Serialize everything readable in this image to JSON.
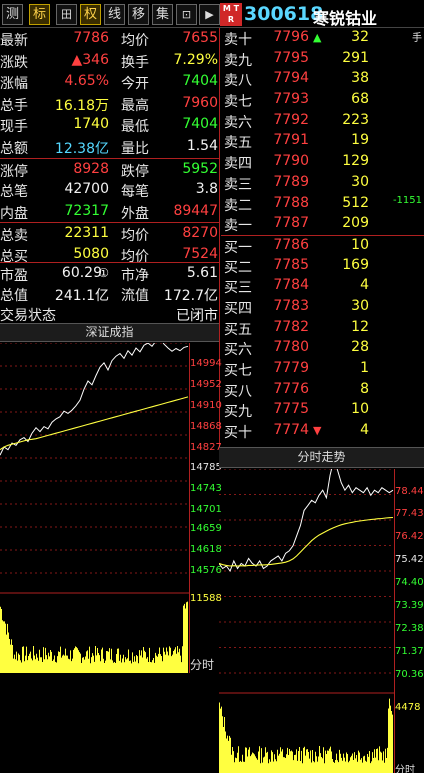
{
  "toolbar": {
    "buttons": [
      {
        "label": "测",
        "active": false
      },
      {
        "label": "标",
        "active": true
      },
      {
        "label": "田",
        "active": false
      },
      {
        "label": "权",
        "active": true
      },
      {
        "label": "线",
        "active": false
      },
      {
        "label": "移",
        "active": false
      },
      {
        "label": "集",
        "active": false
      },
      {
        "label": "⊡",
        "active": false
      },
      {
        "label": "▶",
        "active": false
      }
    ],
    "badge": "M T R",
    "code": "300618",
    "name": "寒锐钴业"
  },
  "quote": {
    "rows": [
      {
        "l1": "最新",
        "v1": "7786",
        "c1": "red",
        "l2": "均价",
        "v2": "7655",
        "c2": "red"
      },
      {
        "l1": "涨跌",
        "v1": "▲346",
        "c1": "red",
        "l2": "换手",
        "v2": "7.29%",
        "c2": "yellow"
      },
      {
        "l1": "涨幅",
        "v1": "4.65%",
        "c1": "red",
        "l2": "今开",
        "v2": "7404",
        "c2": "green"
      },
      {
        "l1": "总手",
        "v1": "16.18万",
        "c1": "yellow",
        "l2": "最高",
        "v2": "7960",
        "c2": "red"
      },
      {
        "l1": "现手",
        "v1": "1740",
        "c1": "yellow",
        "l2": "最低",
        "v2": "7404",
        "c2": "green"
      },
      {
        "l1": "总额",
        "v1": "12.38亿",
        "c1": "cyan",
        "l2": "量比",
        "v2": "1.54",
        "c2": "white"
      },
      {
        "l1": "涨停",
        "v1": "8928",
        "c1": "red",
        "l2": "跌停",
        "v2": "5952",
        "c2": "green"
      },
      {
        "l1": "总笔",
        "v1": "42700",
        "c1": "white",
        "l2": "每笔",
        "v2": "3.8",
        "c2": "white"
      },
      {
        "l1": "内盘",
        "v1": "72317",
        "c1": "green",
        "l2": "外盘",
        "v2": "89447",
        "c2": "red"
      },
      {
        "l1": "总卖",
        "v1": "22311",
        "c1": "yellow",
        "l2": "均价",
        "v2": "8270",
        "c2": "red"
      },
      {
        "l1": "总买",
        "v1": "5080",
        "c1": "yellow",
        "l2": "均价",
        "v2": "7524",
        "c2": "red"
      }
    ],
    "extra": [
      {
        "l1": "市盈",
        "v1": "60.29",
        "v1b": "①",
        "l2": "市净",
        "v2": "5.61"
      },
      {
        "l1": "总值",
        "v1": "241.1亿",
        "v1b": "",
        "l2": "流值",
        "v2": "172.7亿"
      }
    ],
    "status_label": "交易状态",
    "status_value": "已闭市"
  },
  "book": {
    "rows": [
      {
        "label": "卖十",
        "price": "7796",
        "vol": "32",
        "mark": "▲",
        "extra": "手"
      },
      {
        "label": "卖九",
        "price": "7795",
        "vol": "291",
        "mark": "",
        "extra": ""
      },
      {
        "label": "卖八",
        "price": "7794",
        "vol": "38",
        "mark": "",
        "extra": ""
      },
      {
        "label": "卖七",
        "price": "7793",
        "vol": "68",
        "mark": "",
        "extra": ""
      },
      {
        "label": "卖六",
        "price": "7792",
        "vol": "223",
        "mark": "",
        "extra": ""
      },
      {
        "label": "卖五",
        "price": "7791",
        "vol": "19",
        "mark": "",
        "extra": ""
      },
      {
        "label": "卖四",
        "price": "7790",
        "vol": "129",
        "mark": "",
        "extra": ""
      },
      {
        "label": "卖三",
        "price": "7789",
        "vol": "30",
        "mark": "",
        "extra": ""
      },
      {
        "label": "卖二",
        "price": "7788",
        "vol": "512",
        "mark": "",
        "extra": "-1151"
      },
      {
        "label": "卖一",
        "price": "7787",
        "vol": "209",
        "mark": "",
        "extra": ""
      },
      {
        "label": "买一",
        "price": "7786",
        "vol": "10",
        "mark": "",
        "extra": ""
      },
      {
        "label": "买二",
        "price": "7785",
        "vol": "169",
        "mark": "",
        "extra": ""
      },
      {
        "label": "买三",
        "price": "7784",
        "vol": "4",
        "mark": "",
        "extra": ""
      },
      {
        "label": "买四",
        "price": "7783",
        "vol": "30",
        "mark": "",
        "extra": ""
      },
      {
        "label": "买五",
        "price": "7782",
        "vol": "12",
        "mark": "",
        "extra": ""
      },
      {
        "label": "买六",
        "price": "7780",
        "vol": "28",
        "mark": "",
        "extra": ""
      },
      {
        "label": "买七",
        "price": "7779",
        "vol": "1",
        "mark": "",
        "extra": ""
      },
      {
        "label": "买八",
        "price": "7776",
        "vol": "8",
        "mark": "",
        "extra": ""
      },
      {
        "label": "买九",
        "price": "7775",
        "vol": "10",
        "mark": "",
        "extra": ""
      },
      {
        "label": "买十",
        "price": "7774",
        "vol": "4",
        "mark": "▼",
        "extra": ""
      }
    ]
  },
  "index_chart": {
    "title": "深证成指",
    "axis": [
      "14994",
      "14952",
      "14910",
      "14868",
      "14827",
      "14785",
      "14743",
      "14701",
      "14659",
      "14618",
      "14576",
      "11588"
    ],
    "time_label": "分时"
  },
  "stock_chart": {
    "title": "分时走势",
    "axis": [
      "78.44",
      "77.43",
      "76.42",
      "75.42",
      "74.40",
      "73.39",
      "72.38",
      "71.37",
      "70.36",
      "4478"
    ],
    "time_label": "分时"
  },
  "colors": {
    "up": "#ff4040",
    "down": "#33ff33",
    "volume": "#ffff40",
    "code": "#55d8ff",
    "price_line": "#ffffff",
    "avg_line": "#ffff40",
    "grid": "#b02020"
  },
  "chart_data": [
    {
      "type": "line",
      "title": "深证成指",
      "ylim": [
        14576,
        14994
      ],
      "y_ticks": [
        14994,
        14952,
        14910,
        14868,
        14827,
        14785,
        14743,
        14701,
        14659,
        14618,
        14576
      ],
      "series": [
        {
          "values": [
            14790,
            14805,
            14800,
            14812,
            14808,
            14818,
            14822,
            14815,
            14830,
            14840,
            14833,
            14842,
            14838,
            14850,
            14856,
            14860,
            14870,
            14866,
            14872,
            14880,
            14890,
            14910,
            14925,
            14918,
            14935,
            14950,
            14958,
            14945,
            14962,
            14970,
            14975,
            14966,
            14980,
            14972,
            14985,
            14978,
            14990,
            14994,
            14988,
            14998,
            15003,
            14992,
            14985,
            14979,
            14984,
            14980,
            14986,
            14988
          ]
        },
        {
          "values": [
            14800,
            14805,
            14808,
            14810,
            14812,
            14814,
            14816,
            14818,
            14819,
            14820,
            14822,
            14824,
            14826,
            14828,
            14830,
            14832,
            14834,
            14836,
            14838,
            14840,
            14842,
            14844,
            14846,
            14848,
            14850,
            14852,
            14854,
            14856,
            14858,
            14860,
            14862,
            14864,
            14866,
            14868,
            14870,
            14872,
            14874,
            14876,
            14878,
            14880,
            14882,
            14884,
            14886,
            14888,
            14890,
            14892,
            14894,
            14896
          ]
        }
      ]
    },
    {
      "type": "line",
      "title": "分时走势",
      "ylim": [
        70.36,
        78.44
      ],
      "y_ticks": [
        78.44,
        77.43,
        76.42,
        75.42,
        74.4,
        73.39,
        72.38,
        71.37,
        70.36
      ],
      "series": [
        {
          "values": [
            74.7,
            74.5,
            74.6,
            74.4,
            74.8,
            74.5,
            74.7,
            74.6,
            74.9,
            74.7,
            74.6,
            74.8,
            74.5,
            74.6,
            74.8,
            74.9,
            75.0,
            74.8,
            75.1,
            75.2,
            75.4,
            75.8,
            76.2,
            76.8,
            77.0,
            77.2,
            77.1,
            77.4,
            77.6,
            77.3,
            78.2,
            78.8,
            78.4,
            77.9,
            77.6,
            77.8,
            77.5,
            77.7,
            77.6,
            77.5,
            77.7,
            77.4,
            77.6,
            77.5,
            77.7,
            77.6,
            77.5,
            77.6
          ]
        },
        {
          "values": [
            74.7,
            74.65,
            74.62,
            74.6,
            74.61,
            74.6,
            74.61,
            74.6,
            74.62,
            74.62,
            74.63,
            74.64,
            74.64,
            74.65,
            74.66,
            74.68,
            74.7,
            74.72,
            74.75,
            74.8,
            74.88,
            75.0,
            75.15,
            75.3,
            75.45,
            75.6,
            75.72,
            75.82,
            75.9,
            75.98,
            76.05,
            76.12,
            76.18,
            76.23,
            76.27,
            76.3,
            76.33,
            76.36,
            76.38,
            76.4,
            76.42,
            76.44,
            76.45,
            76.47,
            76.48,
            76.5,
            76.51,
            76.52
          ]
        }
      ]
    }
  ]
}
